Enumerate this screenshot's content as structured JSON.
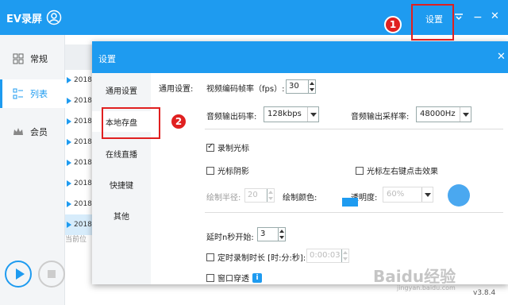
{
  "app": {
    "title": "EV录屏",
    "toolbar": {
      "settings_label": "设置"
    },
    "version": "v3.8.4"
  },
  "sidebar": {
    "items": [
      {
        "label": "常规",
        "icon": "grid-icon"
      },
      {
        "label": "列表",
        "icon": "list-icon"
      },
      {
        "label": "会员",
        "icon": "crown-icon"
      }
    ],
    "active": "列表"
  },
  "list": {
    "rows": [
      "2018.",
      "2018.",
      "2018.",
      "2018.",
      "2018.",
      "2018.",
      "2018.",
      "2018."
    ],
    "selected_row": 7,
    "current_position_label": "当前位"
  },
  "dialog": {
    "title": "设置",
    "nav": [
      "通用设置",
      "本地存盘",
      "在线直播",
      "快捷键",
      "其他"
    ],
    "active_nav": "本地存盘",
    "general_label": "通用设置:",
    "fps_label": "视频编码帧率（fps）:",
    "fps_value": "30",
    "audio_bitrate_label": "音频输出码率:",
    "audio_bitrate_value": "128kbps",
    "sample_rate_label": "音频输出采样率:",
    "sample_rate_value": "48000Hz",
    "record_cursor_label": "录制光标",
    "cursor_shadow_label": "光标阴影",
    "cursor_click_label": "光标左右键点击效果",
    "radius_label": "绘制半径:",
    "radius_value": "20",
    "color_label": "绘制颜色:",
    "opacity_label": "透明度:",
    "opacity_value": "60%",
    "delay_label": "延时n秒开始:",
    "delay_value": "3",
    "timed_label": "定时录制时长 [时:分:秒]:",
    "timed_value": "0:00:03",
    "window_label": "窗口穿透",
    "accent_color": "#1e9bf0"
  },
  "annotations": {
    "badge1": "1",
    "badge2": "2",
    "color": "#e02020"
  },
  "watermark": {
    "text": "Baidu经验",
    "sub": "jingyan.baidu.com"
  }
}
